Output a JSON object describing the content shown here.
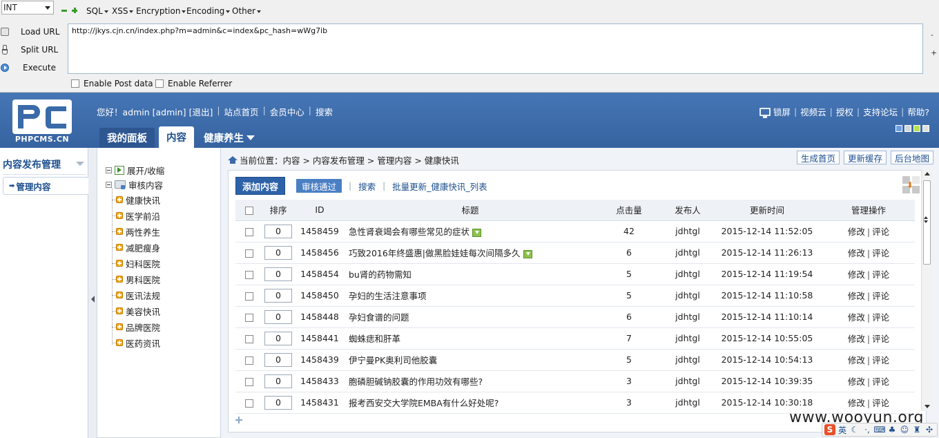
{
  "hackbar": {
    "select_value": "INT",
    "menus": [
      "SQL",
      "XSS",
      "Encryption",
      "Encoding",
      "Other"
    ],
    "load_url": "Load URL",
    "split_url": "Split URL",
    "execute": "Execute",
    "url_value": "http://jkys.cjn.cn/index.php?m=admin&c=index&pc_hash=wWg7ib",
    "url_minus": "-",
    "url_plus": "+",
    "post_label": "Enable Post data",
    "referrer_label": "Enable Referrer"
  },
  "header": {
    "logo_mark": "PC",
    "logo_text": "PHPCMS.CN",
    "greeting": "您好！admin [admin]",
    "logout": "[退出]",
    "site_home": "站点首页",
    "member_center": "会员中心",
    "search": "搜索",
    "lock_screen": "锁屏",
    "video_cloud": "视频云",
    "authorize": "授权",
    "forum": "支持论坛",
    "help": "帮助?",
    "theme_colors": [
      "#6aa0e0",
      "#d0d8e0",
      "#b8e050",
      "#e0e0e0"
    ],
    "tabs": {
      "panel": "我的面板",
      "content": "内容",
      "site": "健康养生"
    }
  },
  "sidebar": {
    "title": "内容发布管理",
    "active_item": "管理内容"
  },
  "tree": {
    "expand": "展开/收缩",
    "review": "审核内容",
    "items": [
      "健康快讯",
      "医学前沿",
      "两性养生",
      "减肥瘦身",
      "妇科医院",
      "男科医院",
      "医讯法规",
      "美容快讯",
      "品牌医院",
      "医药资讯"
    ]
  },
  "main": {
    "breadcrumb": "当前位置：内容 > 内容发布管理 > 管理内容 > 健康快讯",
    "btn_generate": "生成首页",
    "btn_cache": "更新缓存",
    "btn_map": "后台地图",
    "add_content": "添加内容",
    "approve": "审核通过",
    "search": "搜索",
    "batch_update": "批量更新_健康快讯_列表",
    "columns": {
      "order": "排序",
      "id": "ID",
      "title": "标题",
      "hits": "点击量",
      "author": "发布人",
      "updated": "更新时间",
      "ops": "管理操作"
    },
    "op_edit": "修改",
    "op_sep": "|",
    "op_comment": "评论",
    "rows": [
      {
        "order": "0",
        "id": "1458459",
        "title": "急性肾衰竭会有哪些常见的症状",
        "img": true,
        "hits": "42",
        "author": "jdhtgl",
        "time": "2015-12-14 11:52:05"
      },
      {
        "order": "0",
        "id": "1458456",
        "title": "巧致2016年终盛惠|做黑脸娃娃每次间隔多久",
        "img": true,
        "hits": "6",
        "author": "jdhtgl",
        "time": "2015-12-14 11:26:13"
      },
      {
        "order": "0",
        "id": "1458454",
        "title": "bu肾的药物需知",
        "img": false,
        "hits": "5",
        "author": "jdhtgl",
        "time": "2015-12-14 11:19:54"
      },
      {
        "order": "0",
        "id": "1458450",
        "title": "孕妇的生活注意事项",
        "img": false,
        "hits": "5",
        "author": "jdhtgl",
        "time": "2015-12-14 11:10:58"
      },
      {
        "order": "0",
        "id": "1458448",
        "title": "孕妇食谱的问题",
        "img": false,
        "hits": "6",
        "author": "jdhtgl",
        "time": "2015-12-14 11:10:14"
      },
      {
        "order": "0",
        "id": "1458441",
        "title": "蜘蛛痣和肝革",
        "img": false,
        "hits": "7",
        "author": "jdhtgl",
        "time": "2015-12-14 10:55:05"
      },
      {
        "order": "0",
        "id": "1458439",
        "title": "伊宁曼PK奥利司他胶囊",
        "img": false,
        "hits": "5",
        "author": "jdhtgl",
        "time": "2015-12-14 10:54:13"
      },
      {
        "order": "0",
        "id": "1458433",
        "title": "胞磷胆碱钠胶囊的作用功效有哪些?",
        "img": false,
        "hits": "3",
        "author": "jdhtgl",
        "time": "2015-12-14 10:39:35"
      },
      {
        "order": "0",
        "id": "1458431",
        "title": "报考西安交大学院EMBA有什么好处呢?",
        "img": false,
        "hits": "3",
        "author": "jdhtgl",
        "time": "2015-12-14 10:30:18"
      }
    ]
  },
  "watermark": "www.wooyun.org",
  "ime": {
    "lang": "英"
  }
}
